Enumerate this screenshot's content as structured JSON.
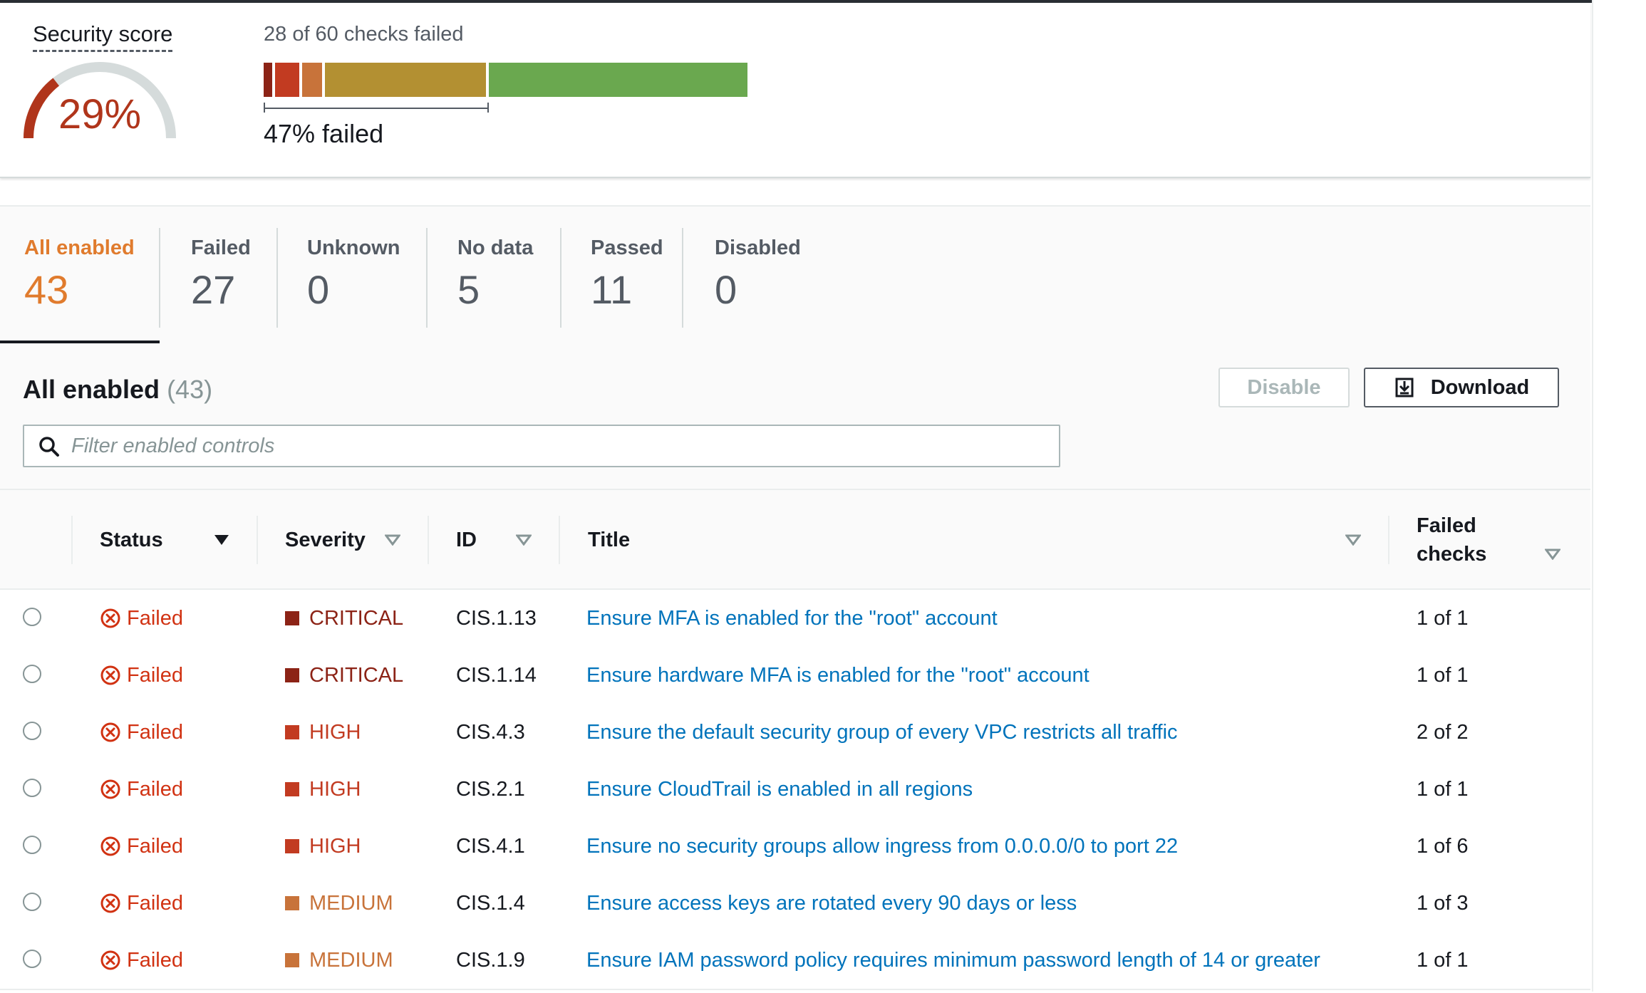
{
  "score": {
    "label": "Security score",
    "percent_text": "29%",
    "percent_value": 29,
    "checks_text": "28 of 60 checks failed",
    "failed_text": "47% failed",
    "bar_segments": [
      {
        "severity": "critical",
        "share": 0.023,
        "color": "#8c2316"
      },
      {
        "severity": "high",
        "share": 0.055,
        "color": "#c23b21"
      },
      {
        "severity": "medium",
        "share": 0.047,
        "color": "#c8733a"
      },
      {
        "severity": "low",
        "share": 0.337,
        "color": "#b39032"
      },
      {
        "severity": "passed",
        "share": 0.538,
        "color": "#6aa84f"
      }
    ]
  },
  "counters": [
    {
      "label": "All enabled",
      "value": "43"
    },
    {
      "label": "Failed",
      "value": "27"
    },
    {
      "label": "Unknown",
      "value": "0"
    },
    {
      "label": "No data",
      "value": "5"
    },
    {
      "label": "Passed",
      "value": "11"
    },
    {
      "label": "Disabled",
      "value": "0"
    }
  ],
  "section": {
    "title": "All enabled",
    "count": "(43)"
  },
  "buttons": {
    "disable": "Disable",
    "download": "Download"
  },
  "search": {
    "placeholder": "Filter enabled controls"
  },
  "columns": {
    "status": "Status",
    "severity": "Severity",
    "id": "ID",
    "title": "Title",
    "failed_checks": "Failed checks"
  },
  "rows": [
    {
      "status": "Failed",
      "severity": "CRITICAL",
      "id": "CIS.1.13",
      "title": "Ensure MFA is enabled for the \"root\" account",
      "failed_checks": "1 of 1"
    },
    {
      "status": "Failed",
      "severity": "CRITICAL",
      "id": "CIS.1.14",
      "title": "Ensure hardware MFA is enabled for the \"root\" account",
      "failed_checks": "1 of 1"
    },
    {
      "status": "Failed",
      "severity": "HIGH",
      "id": "CIS.4.3",
      "title": "Ensure the default security group of every VPC restricts all traffic",
      "failed_checks": "2 of 2"
    },
    {
      "status": "Failed",
      "severity": "HIGH",
      "id": "CIS.2.1",
      "title": "Ensure CloudTrail is enabled in all regions",
      "failed_checks": "1 of 1"
    },
    {
      "status": "Failed",
      "severity": "HIGH",
      "id": "CIS.4.1",
      "title": "Ensure no security groups allow ingress from 0.0.0.0/0 to port 22",
      "failed_checks": "1 of 6"
    },
    {
      "status": "Failed",
      "severity": "MEDIUM",
      "id": "CIS.1.4",
      "title": "Ensure access keys are rotated every 90 days or less",
      "failed_checks": "1 of 3"
    },
    {
      "status": "Failed",
      "severity": "MEDIUM",
      "id": "CIS.1.9",
      "title": "Ensure IAM password policy requires minimum password length of 14 or greater",
      "failed_checks": "1 of 1"
    }
  ],
  "colors": {
    "accent": "#e07b2d",
    "failed": "#d13212",
    "critical": "#8c2316",
    "high": "#c23b21",
    "medium": "#c8733a",
    "link": "#0073bb"
  }
}
